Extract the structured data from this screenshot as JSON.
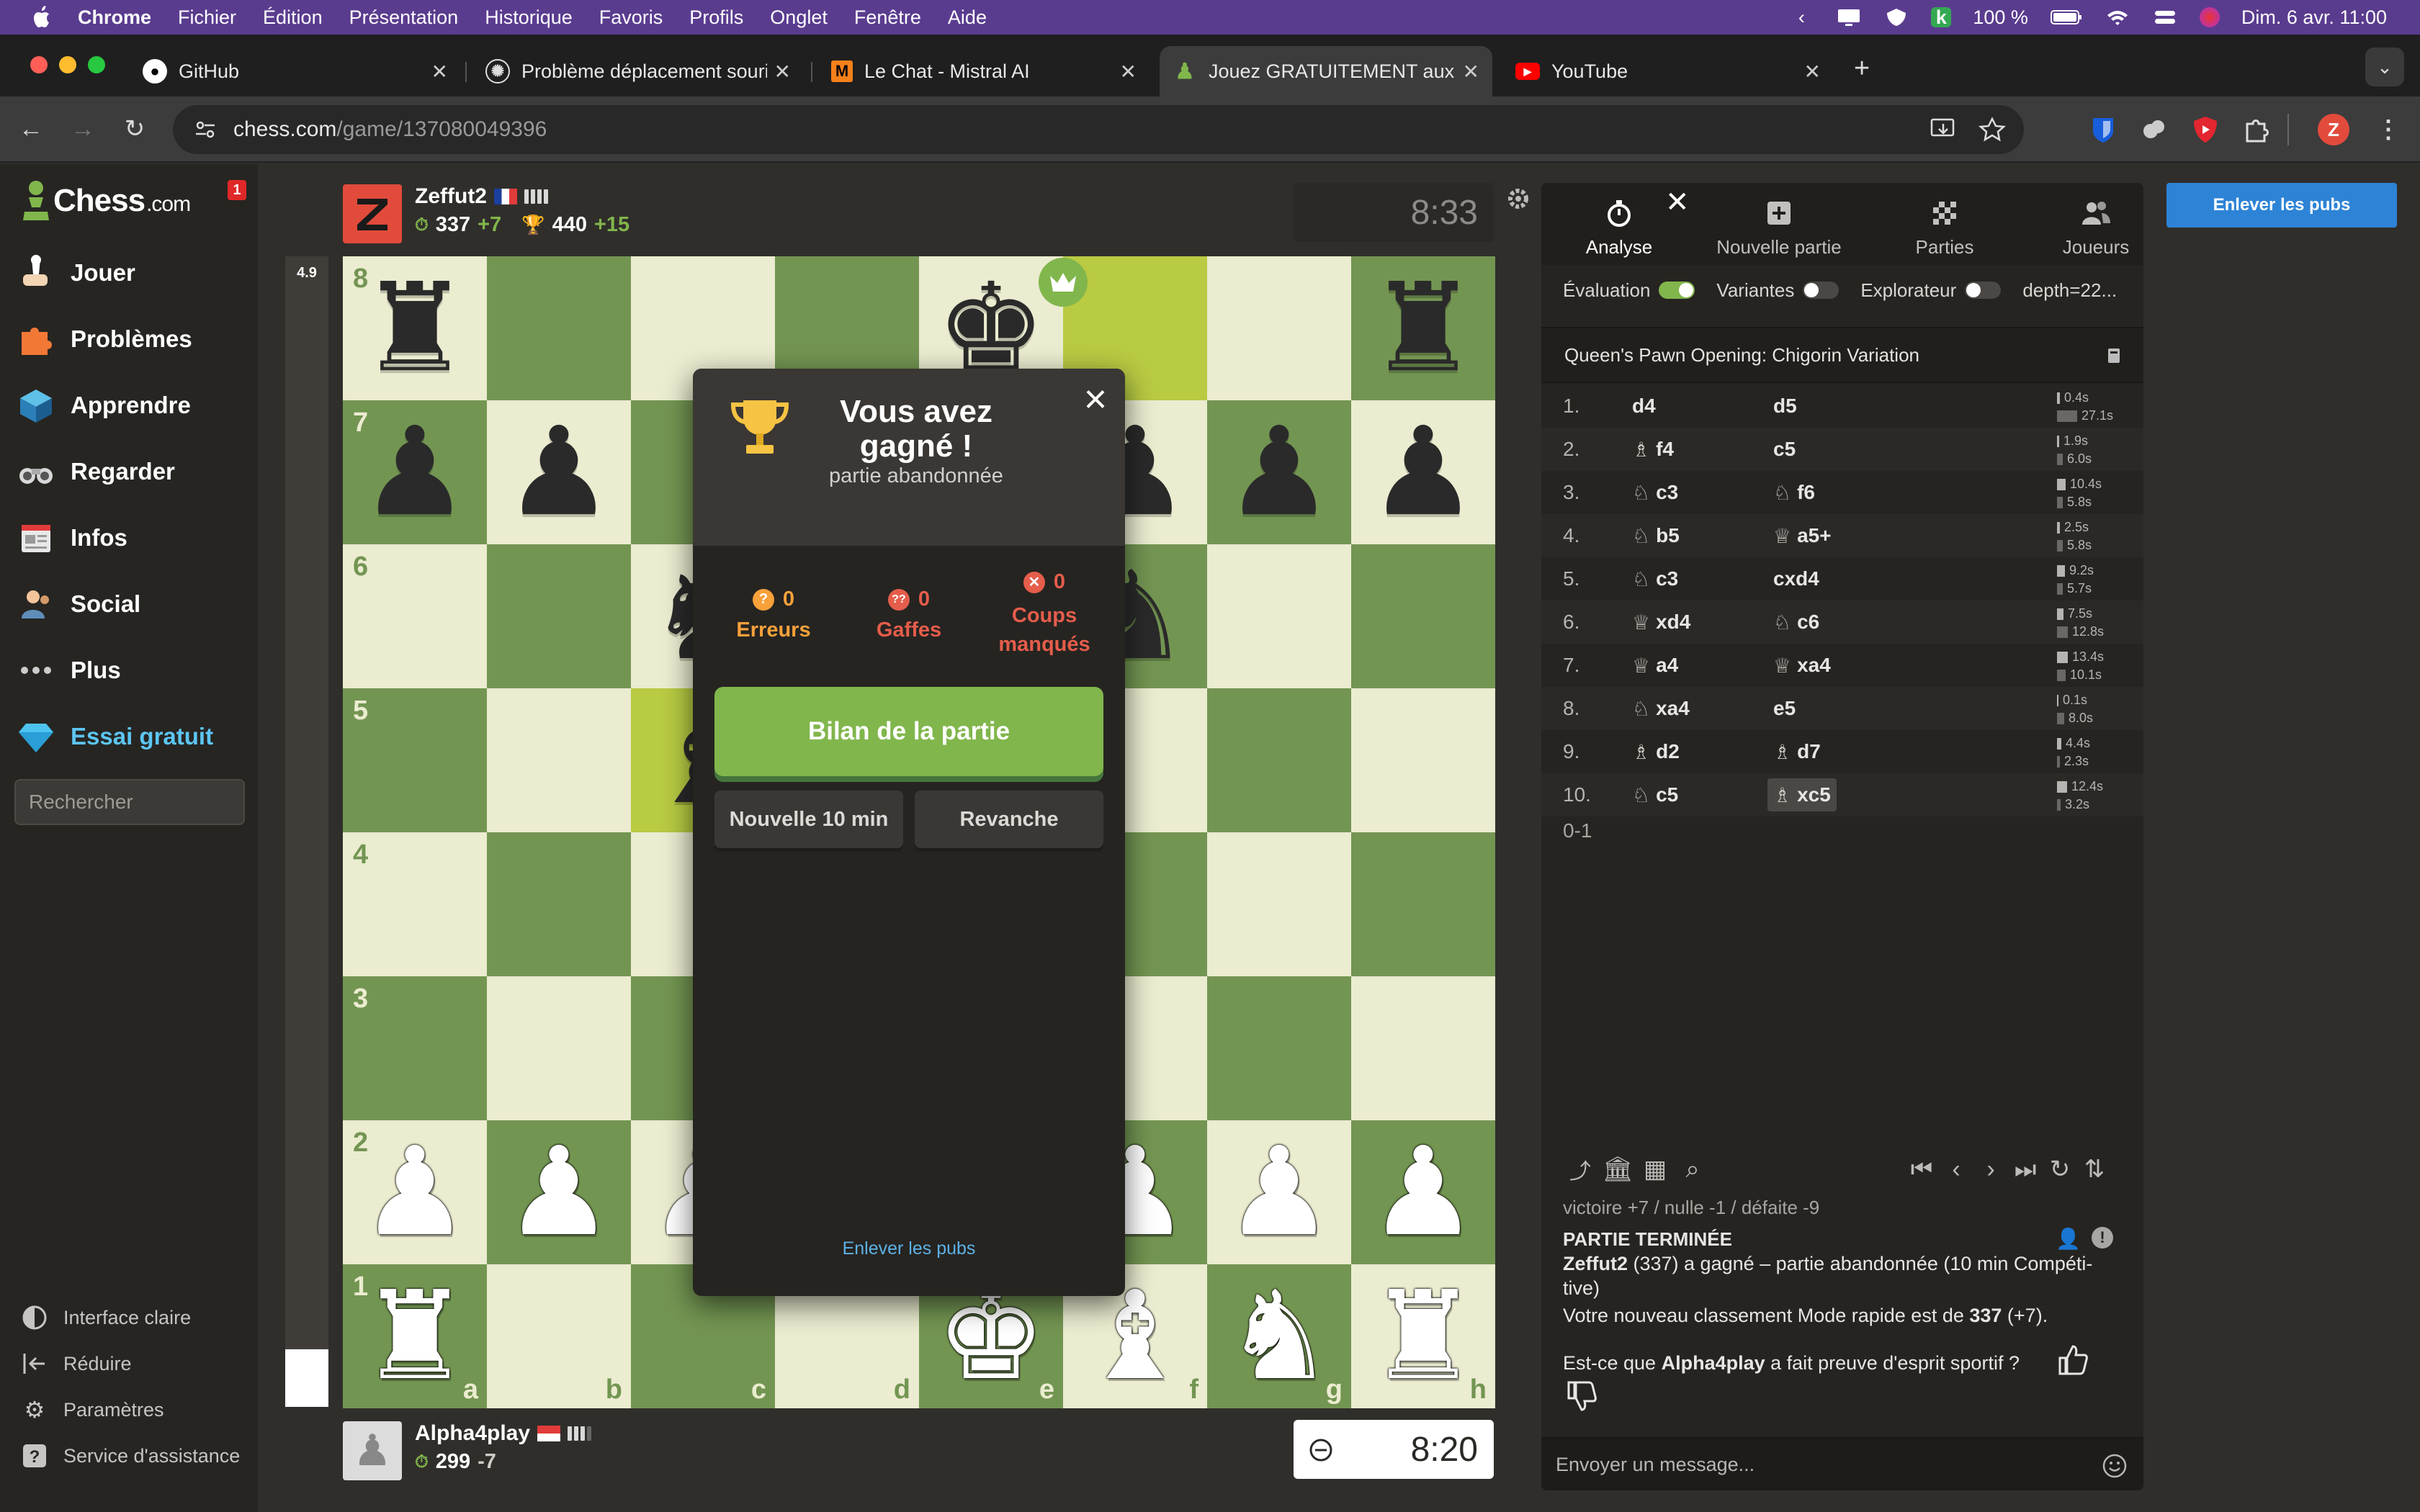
{
  "menubar": {
    "app": "Chrome",
    "items": [
      "Fichier",
      "Édition",
      "Présentation",
      "Historique",
      "Favoris",
      "Profils",
      "Onglet",
      "Fenêtre",
      "Aide"
    ],
    "battery": "100 %",
    "datetime": "Dim. 6 avr.  11:00"
  },
  "tabs": [
    {
      "title": "GitHub",
      "icon": "github-icon"
    },
    {
      "title": "Problème déplacement souris",
      "icon": "openai-icon"
    },
    {
      "title": "Le Chat - Mistral AI",
      "icon": "mistral-icon"
    },
    {
      "title": "Jouez GRATUITEMENT aux échecs",
      "icon": "chess-pawn-icon",
      "active": true
    },
    {
      "title": "YouTube",
      "icon": "youtube-icon"
    }
  ],
  "address": {
    "host": "chess.com",
    "path": "/game/137080049396"
  },
  "sidebar": {
    "logo_main": "Chess",
    "logo_suffix": ".com",
    "notification_count": "1",
    "items": [
      {
        "label": "Jouer",
        "icon": "play-hand-icon"
      },
      {
        "label": "Problèmes",
        "icon": "puzzle-icon"
      },
      {
        "label": "Apprendre",
        "icon": "learn-cube-icon"
      },
      {
        "label": "Regarder",
        "icon": "binoculars-icon"
      },
      {
        "label": "Infos",
        "icon": "newspaper-icon"
      },
      {
        "label": "Social",
        "icon": "social-icon"
      },
      {
        "label": "Plus",
        "icon": "more-dots-icon"
      },
      {
        "label": "Essai gratuit",
        "icon": "diamond-icon"
      }
    ],
    "search_placeholder": "Rechercher",
    "bottom": [
      {
        "label": "Interface claire",
        "icon": "contrast-icon"
      },
      {
        "label": "Réduire",
        "icon": "collapse-icon"
      },
      {
        "label": "Paramètres",
        "icon": "gear-icon"
      },
      {
        "label": "Service d'assistance",
        "icon": "help-icon"
      }
    ]
  },
  "eval": "4.9",
  "top_player": {
    "name": "Zeffut2",
    "rating": "337",
    "rating_change": "+7",
    "trophy": "440",
    "trophy_change": "+15",
    "clock": "8:33"
  },
  "bottom_player": {
    "name": "Alpha4play",
    "rating": "299",
    "rating_change": "-7",
    "clock": "8:20"
  },
  "board": {
    "ranks": [
      "8",
      "7",
      "6",
      "5",
      "4",
      "3",
      "2",
      "1"
    ],
    "files": [
      "a",
      "b",
      "c",
      "d",
      "e",
      "f",
      "g",
      "h"
    ],
    "rows": [
      [
        "bR",
        "",
        "",
        "",
        "bK",
        "",
        "",
        "bR"
      ],
      [
        "bP",
        "bP",
        "",
        "",
        "",
        "bP",
        "bP",
        "bP"
      ],
      [
        "",
        "",
        "bN",
        "",
        "",
        "bN",
        "",
        ""
      ],
      [
        "",
        "",
        "bB",
        "",
        "",
        "",
        "",
        ""
      ],
      [
        "",
        "",
        "",
        "",
        "",
        "",
        "",
        ""
      ],
      [
        "",
        "",
        "",
        "",
        "",
        "",
        "",
        ""
      ],
      [
        "wP",
        "wP",
        "wP",
        "",
        "",
        "wP",
        "wP",
        "wP"
      ],
      [
        "wR",
        "",
        "",
        "",
        "wK",
        "wB",
        "wN",
        "wR"
      ]
    ]
  },
  "modal": {
    "title": "Vous avez gagné !",
    "subtitle": "partie abandonnée",
    "stats": [
      {
        "count": "0",
        "label": "Erreurs"
      },
      {
        "count": "0",
        "label": "Gaffes"
      },
      {
        "count": "0",
        "label": "Coups manqués"
      }
    ],
    "review": "Bilan de la partie",
    "new_game": "Nouvelle 10 min",
    "rematch": "Revanche",
    "remove_ads": "Enlever les pubs"
  },
  "panel": {
    "tabs": [
      "Analyse",
      "Nouvelle partie",
      "Parties",
      "Joueurs"
    ],
    "toggles": [
      {
        "label": "Évaluation",
        "on": true
      },
      {
        "label": "Variantes",
        "on": false
      },
      {
        "label": "Explorateur",
        "on": false
      }
    ],
    "depth": "depth=22...",
    "opening": "Queen's Pawn Opening: Chigorin Variation",
    "moves": [
      {
        "n": "1.",
        "w": "d4",
        "wp": "",
        "b": "d5",
        "bp": "",
        "tw": "0.4s",
        "tb": "27.1s",
        "ww": 4,
        "bw": 28
      },
      {
        "n": "2.",
        "w": "f4",
        "wp": "♗",
        "b": "c5",
        "bp": "",
        "tw": "1.9s",
        "tb": "6.0s",
        "ww": 3,
        "bw": 8
      },
      {
        "n": "3.",
        "w": "c3",
        "wp": "♘",
        "b": "f6",
        "bp": "♘",
        "tw": "10.4s",
        "tb": "5.8s",
        "ww": 12,
        "bw": 8
      },
      {
        "n": "4.",
        "w": "b5",
        "wp": "♘",
        "b": "a5+",
        "bp": "♕",
        "tw": "2.5s",
        "tb": "5.8s",
        "ww": 4,
        "bw": 8
      },
      {
        "n": "5.",
        "w": "c3",
        "wp": "♘",
        "b": "cxd4",
        "bp": "",
        "tw": "9.2s",
        "tb": "5.7s",
        "ww": 11,
        "bw": 8
      },
      {
        "n": "6.",
        "w": "xd4",
        "wp": "♕",
        "b": "c6",
        "bp": "♘",
        "tw": "7.5s",
        "tb": "12.8s",
        "ww": 9,
        "bw": 15
      },
      {
        "n": "7.",
        "w": "a4",
        "wp": "♕",
        "b": "xa4",
        "bp": "♕",
        "tw": "13.4s",
        "tb": "10.1s",
        "ww": 15,
        "bw": 12
      },
      {
        "n": "8.",
        "w": "xa4",
        "wp": "♘",
        "b": "e5",
        "bp": "",
        "tw": "0.1s",
        "tb": "8.0s",
        "ww": 2,
        "bw": 10
      },
      {
        "n": "9.",
        "w": "d2",
        "wp": "♗",
        "b": "d7",
        "bp": "♗",
        "tw": "4.4s",
        "tb": "2.3s",
        "ww": 6,
        "bw": 4
      },
      {
        "n": "10.",
        "w": "c5",
        "wp": "♘",
        "b": "xc5",
        "bp": "♗",
        "tw": "12.4s",
        "tb": "3.2s",
        "ww": 14,
        "bw": 5
      }
    ],
    "result": "0-1",
    "chat_cut": "victoire +7 / nulle -1 / défaite -9",
    "chat_title": "PARTIE TERMINÉE",
    "chat_winner": "Zeffut2",
    "chat_line1": " (337) a gagné – partie abandonnée (10 min Compéti-tive)",
    "chat_line2a": "Votre nouveau classement Mode rapide est de ",
    "chat_line2b": "337",
    "chat_line2c": " (+7).",
    "chat_q1": "Est-ce que ",
    "chat_q2": "Alpha4play",
    "chat_q3": " a fait preuve d'esprit sportif ?",
    "chat_placeholder": "Envoyer un message..."
  },
  "ad_button": "Enlever les pubs",
  "colors": {
    "board_light": "#ebecd0",
    "board_dark": "#739552",
    "accent_green": "#81b64c",
    "link_blue": "#5cb2e6"
  }
}
